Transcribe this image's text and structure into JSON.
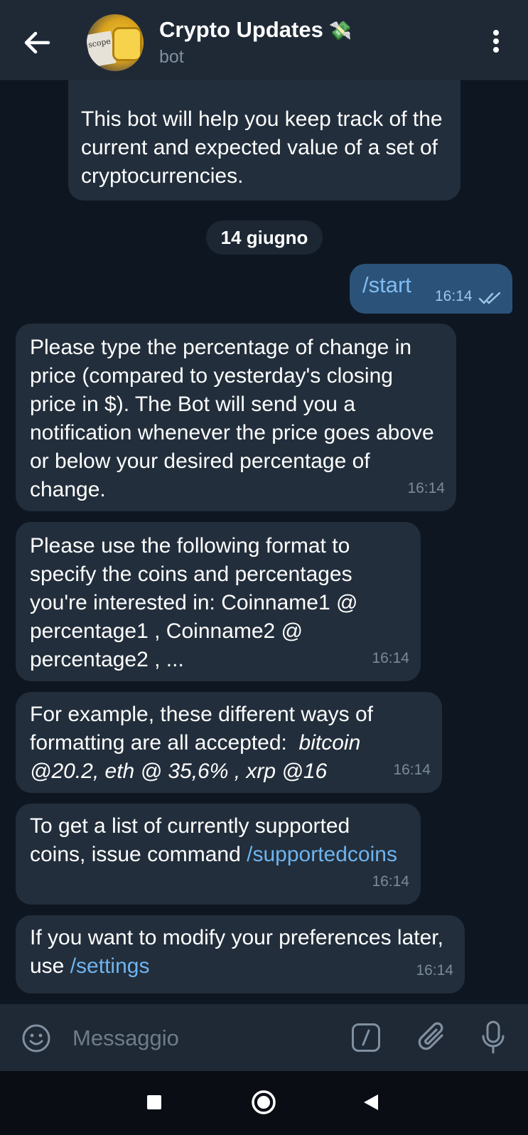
{
  "header": {
    "title": "Crypto Updates",
    "title_emoji": "💸",
    "subtitle": "bot",
    "avatar_text": "scope",
    "icons": {
      "back": "arrow-left-icon",
      "menu": "more-vertical-icon"
    }
  },
  "messages": {
    "intro": {
      "text": "This bot will help you keep track of the current and expected value of a set of cryptocurrencies."
    },
    "date_separator": "14 giugno",
    "outgoing": {
      "text": "/start",
      "time": "16:14",
      "status": "read"
    },
    "msg1": {
      "text": "Please type the percentage of change in price (compared to yesterday's closing price in $). The Bot will send you a notification whenever the price goes above or below your desired percentage of change.",
      "time": "16:14"
    },
    "msg2": {
      "text": "Please use the following format to specify the coins and percentages you're interested in: Coinname1 @ percentage1 , Coinname2 @ percentage2 , ...",
      "time": "16:14"
    },
    "msg3": {
      "text_plain": "For example, these different ways of formatting are all accepted:  ",
      "text_italic": "bitcoin @20.2, eth @ 35,6% , xrp @16",
      "time": "16:14"
    },
    "msg4": {
      "text_plain": "To get a list of currently supported coins, issue command ",
      "link": "/supportedcoins",
      "time": "16:14"
    },
    "msg5": {
      "text_plain": "If you want to modify your preferences later, use ",
      "link": "/settings",
      "time": "16:14"
    }
  },
  "composer": {
    "placeholder": "Messaggio",
    "icons": {
      "emoji": "smiley-icon",
      "command": "slash-command-icon",
      "attach": "paperclip-icon",
      "mic": "microphone-icon"
    }
  },
  "navbar": {
    "icons": {
      "recents": "square-icon",
      "home": "circle-home-icon",
      "back": "triangle-back-icon"
    }
  },
  "colors": {
    "background": "#0e1621",
    "header": "#1f2936",
    "incoming_bubble": "#222e3b",
    "outgoing_bubble": "#2b5278",
    "link": "#6eb4f0",
    "muted": "#7b8a99"
  }
}
